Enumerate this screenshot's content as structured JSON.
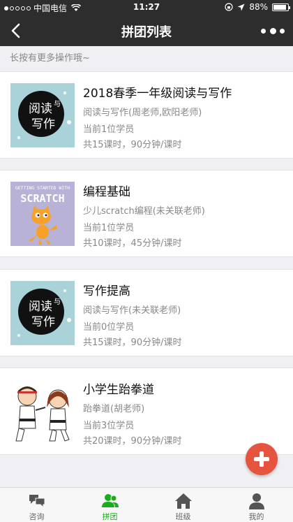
{
  "status_bar": {
    "carrier": "中国电信",
    "time": "11:27",
    "battery": "88%",
    "battery_level": 0.88
  },
  "nav": {
    "title": "拼团列表"
  },
  "hint": "长按有更多操作哦~",
  "groups": [
    {
      "title": "2018春季一年级阅读与写作",
      "course": "阅读与写作(周老师,欧阳老师)",
      "students": "当前1位学员",
      "schedule": "共15课时，90分钟/课时",
      "thumb_icon": "reading-writing-icon"
    },
    {
      "title": "编程基础",
      "course": "少儿scratch编程(未关联老师)",
      "students": "当前1位学员",
      "schedule": "共10课时，45分钟/课时",
      "thumb_icon": "scratch-cat-icon",
      "thumb_text_top": "GETTING STARTED WITH",
      "thumb_text_main": "SCRATCH"
    },
    {
      "title": "写作提高",
      "course": "阅读与写作(未关联老师)",
      "students": "当前0位学员",
      "schedule": "共15课时，90分钟/课时",
      "thumb_icon": "reading-writing-icon"
    },
    {
      "title": "小学生跆拳道",
      "course": "跆拳道(胡老师)",
      "students": "当前3位学员",
      "schedule": "共20课时，90分钟/课时",
      "thumb_icon": "taekwondo-kids-icon"
    }
  ],
  "book_cover_text": {
    "word1": "阅读",
    "word2": "与",
    "word3": "写作"
  },
  "tabs": [
    {
      "label": "咨询",
      "icon": "chat-icon"
    },
    {
      "label": "拼团",
      "icon": "group-icon",
      "active": true
    },
    {
      "label": "班级",
      "icon": "home-icon"
    },
    {
      "label": "我的",
      "icon": "profile-icon"
    }
  ],
  "colors": {
    "bar_dark": "#2d2d2d",
    "active_green": "#1aad19",
    "fab_red": "#e6533f",
    "muted_text": "#888888"
  }
}
